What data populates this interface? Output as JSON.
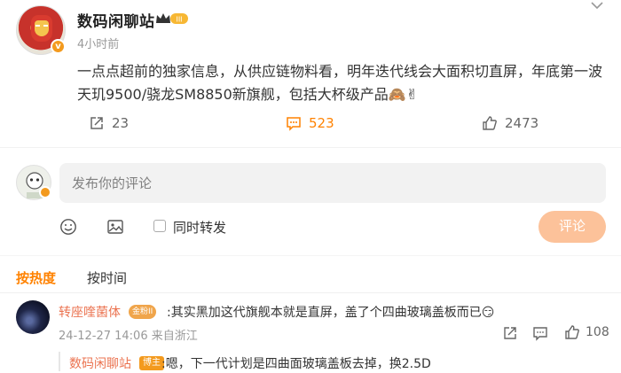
{
  "post": {
    "author": "数码闲聊站",
    "badge_level": "III",
    "time": "4小时前",
    "text": "一点点超前的独家信息，从供应链物料看，明年迭代线会大面积切直屏，年底第一波天玑9500/骁龙SM8850新旗舰，包括大杯级产品🙈✌",
    "repost_count": "23",
    "comment_count": "523",
    "like_count": "2473"
  },
  "composer": {
    "placeholder": "发布你的评论",
    "also_repost_label": "同时转发",
    "submit_label": "评论"
  },
  "sort_tabs": {
    "hot": "按热度",
    "time": "按时间"
  },
  "comments": [
    {
      "name": "转座喹菌体",
      "badge": "金粉II",
      "text": ":其实黑加这代旗舰本就是直屏，盖了个四曲玻璃盖板而已😏",
      "meta": "24-12-27 14:06 来自浙江",
      "like_count": "108",
      "reply": {
        "name": "数码闲聊站",
        "badge": "博主",
        "text": ":嗯，下一代计划是四曲面玻璃盖板去掉，换2.5D"
      }
    }
  ],
  "colors": {
    "accent": "#ff8200",
    "name_link": "#eb7350",
    "submit_disabled": "#fcc29a"
  }
}
